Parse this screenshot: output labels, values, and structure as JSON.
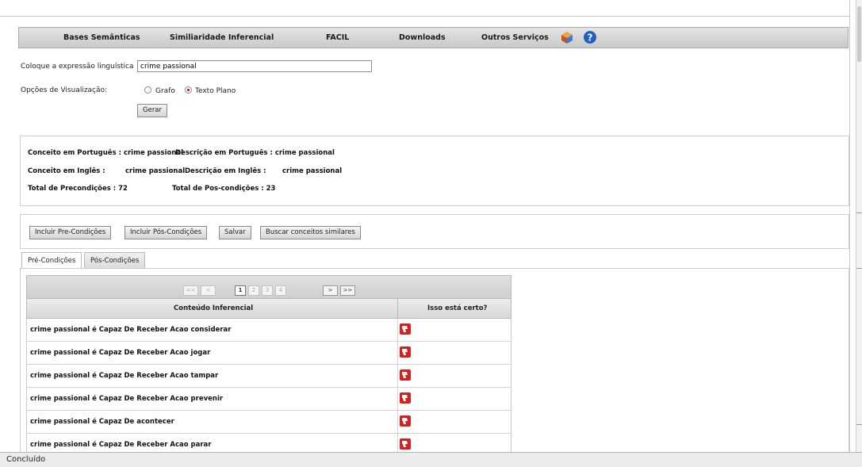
{
  "nav": {
    "items": [
      "Bases Semânticas",
      "Similiaridade Inferencial",
      "FACIL",
      "Downloads",
      "Outros Serviços"
    ],
    "icons": [
      "cube-icon",
      "help-icon"
    ]
  },
  "form": {
    "expr_label": "Coloque a expressão linguística",
    "expr_value": "crime passional",
    "vis_label": "Opções de Visualização:",
    "opt_graph": "Grafo",
    "opt_text": "Texto Plano",
    "selected": "Texto Plano",
    "generate": "Gerar"
  },
  "info": {
    "line1_a": "Conceito em Português : crime passional",
    "line1_b": "Descrição em Português : crime passional",
    "line2_a": "Conceito em Inglês :",
    "line2_b": "crime passional",
    "line2_c": "Descrição em Inglês :",
    "line2_d": "crime passional",
    "line3_a": "Total de Precondições : 72",
    "line3_b": "Total de Pos-condições : 23"
  },
  "actions": [
    "Incluir Pre-Condições",
    "Incluir Pós-Condições",
    "Salvar",
    "Buscar conceitos similares"
  ],
  "tabs": [
    "Pré-Condições",
    "Pós-Condições"
  ],
  "pager": {
    "first": "<<",
    "prev": "<",
    "pages": [
      "1",
      "2",
      "3",
      "4"
    ],
    "next": ">",
    "last": ">>",
    "current": "1"
  },
  "table": {
    "headers": [
      "Conteúdo Inferencial",
      "Isso está certo?"
    ],
    "rows": [
      "crime passional é Capaz De Receber Acao considerar",
      "crime passional é Capaz De Receber Acao jogar",
      "crime passional é Capaz De Receber Acao tampar",
      "crime passional é Capaz De Receber Acao prevenir",
      "crime passional é Capaz De acontecer",
      "crime passional é Capaz De Receber Acao parar"
    ]
  },
  "status": "Concluído",
  "colors": {
    "thumb": "#d42222",
    "radio_selected": "#c00000",
    "help_icon": "#1f5fbf"
  }
}
